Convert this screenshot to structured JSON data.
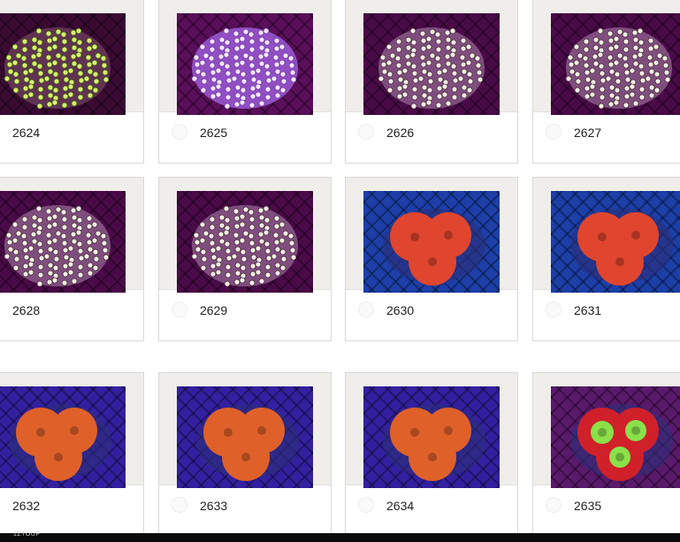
{
  "grid": {
    "items": [
      {
        "id": "2624",
        "theme": "green-polyp"
      },
      {
        "id": "2625",
        "theme": "purple-polyp"
      },
      {
        "id": "2626",
        "theme": "white-polyp"
      },
      {
        "id": "2627",
        "theme": "white-polyp"
      },
      {
        "id": "2628",
        "theme": "white-polyp"
      },
      {
        "id": "2629",
        "theme": "white-polyp"
      },
      {
        "id": "2630",
        "theme": "red-blasto"
      },
      {
        "id": "2631",
        "theme": "red-blasto"
      },
      {
        "id": "2632",
        "theme": "orange-blasto"
      },
      {
        "id": "2633",
        "theme": "orange-blasto"
      },
      {
        "id": "2634",
        "theme": "orange-blasto"
      },
      {
        "id": "2635",
        "theme": "red-green-blasto"
      }
    ]
  },
  "footer": {
    "text": "1ZTOUP"
  },
  "colors": {
    "frame": "#efeeea",
    "magenta_bg": "#8a1a6b",
    "blue_bg": "#1f3fb0"
  }
}
